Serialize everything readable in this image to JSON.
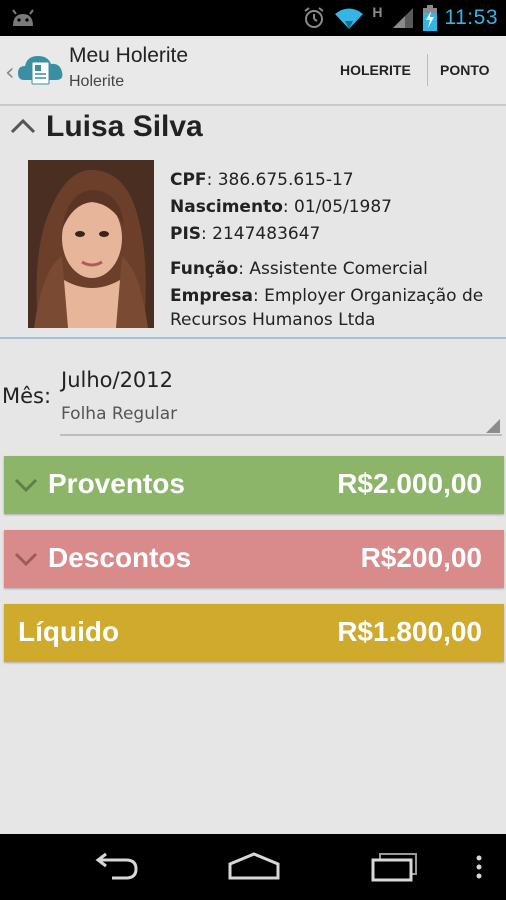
{
  "status_bar": {
    "time": "11:53",
    "network": "H",
    "icons": [
      "android-icon",
      "alarm-icon",
      "wifi-icon",
      "signal-icon",
      "battery-charging-icon"
    ]
  },
  "action_bar": {
    "title": "Meu Holerite",
    "subtitle": "Holerite",
    "actions": [
      "HOLERITE",
      "PONTO"
    ]
  },
  "profile": {
    "name": "Luisa Silva",
    "cpf_label": "CPF",
    "cpf": "386.675.615-17",
    "nascimento_label": "Nascimento",
    "nascimento": "01/05/1987",
    "pis_label": "PIS",
    "pis": "2147483647",
    "funcao_label": "Função",
    "funcao": "Assistente Comercial",
    "empresa_label": "Empresa",
    "empresa_line1": "Employer Organização de",
    "empresa_line2": "Recursos Humanos Ltda"
  },
  "month_selector": {
    "label": "Mês:",
    "value": "Julho/2012",
    "sub": "Folha Regular"
  },
  "summary": [
    {
      "label": "Proventos",
      "amount": "R$2.000,00",
      "color": "#8db56a"
    },
    {
      "label": "Descontos",
      "amount": "R$200,00",
      "color": "#d98a8a"
    },
    {
      "label": "Líquido",
      "amount": "R$1.800,00",
      "color": "#cfaa2c"
    }
  ],
  "colors": {
    "status_accent": "#33b5e5",
    "action_bar_bg": "#e9e9e9",
    "content_bg": "#e6e6e6"
  }
}
